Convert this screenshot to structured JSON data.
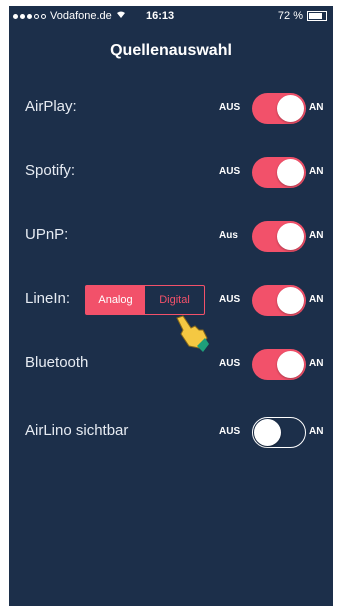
{
  "status": {
    "carrier": "Vodafone.de",
    "time": "16:13",
    "battery": "72 %"
  },
  "header": {
    "title": "Quellenauswahl"
  },
  "rows": [
    {
      "label": "AirPlay:",
      "off_label": "AUS",
      "on_label": "AN",
      "state": "on"
    },
    {
      "label": "Spotify:",
      "off_label": "AUS",
      "on_label": "AN",
      "state": "on"
    },
    {
      "label": "UPnP:",
      "off_label": "Aus",
      "on_label": "AN",
      "state": "on"
    },
    {
      "label": "LineIn:",
      "off_label": "AUS",
      "on_label": "AN",
      "state": "on",
      "segment": {
        "options": [
          "Analog",
          "Digital"
        ],
        "selected": "Analog"
      }
    },
    {
      "label": "Bluetooth",
      "off_label": "AUS",
      "on_label": "AN",
      "state": "on"
    },
    {
      "label": "AirLino sichtbar",
      "off_label": "AUS",
      "on_label": "AN",
      "state": "off"
    }
  ],
  "colors": {
    "background": "#1c2f4a",
    "accent": "#f2516a",
    "text": "#ffffff"
  },
  "icons": {
    "pointer": "hand-pointer-icon",
    "wifi": "wifi-icon",
    "battery": "battery-icon"
  }
}
